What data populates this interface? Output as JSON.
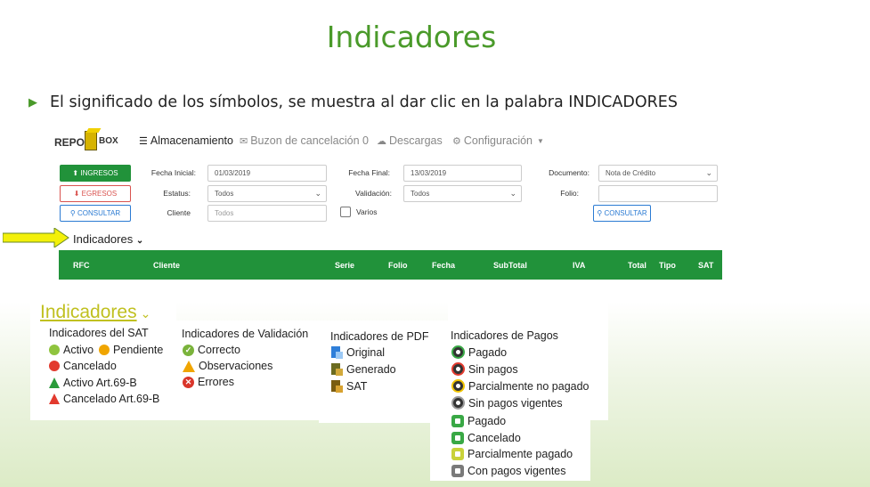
{
  "slide": {
    "title": "Indicadores",
    "bullet": "El significado de los símbolos, se muestra al dar clic en la palabra INDICADORES"
  },
  "app": {
    "logo": {
      "repo": "REPO",
      "box": "BOX"
    },
    "nav": {
      "storage": "Almacenamiento",
      "buzon": "Buzon de cancelación 0",
      "descargas": "Descargas",
      "configuracion": "Configuración"
    },
    "buttons": {
      "ingresos": "INGRESOS",
      "egresos": "EGRESOS",
      "consultar_left": "CONSULTAR",
      "consultar_right": "CONSULTAR"
    },
    "filters": {
      "fecha_inicial_label": "Fecha Inicial:",
      "fecha_inicial_value": "01/03/2019",
      "fecha_final_label": "Fecha Final:",
      "fecha_final_value": "13/03/2019",
      "documento_label": "Documento:",
      "documento_value": "Nota de Crédito",
      "estatus_label": "Estatus:",
      "estatus_value": "Todos",
      "validacion_label": "Validación:",
      "validacion_value": "Todos",
      "folio_label": "Folio:",
      "folio_value": "",
      "cliente_label": "Cliente",
      "cliente_placeholder": "Todos",
      "varios_label": "Varios"
    },
    "indicadores_link": "Indicadores",
    "table_headers": {
      "rfc": "RFC",
      "cliente": "Cliente",
      "serie": "Serie",
      "folio": "Folio",
      "fecha": "Fecha",
      "subtotal": "SubTotal",
      "iva": "IVA",
      "total": "Total",
      "tipo": "Tipo",
      "sat": "SAT"
    }
  },
  "legend": {
    "title": "Indicadores",
    "sat": {
      "title": "Indicadores del SAT",
      "activo": "Activo",
      "pendiente": "Pendiente",
      "cancelado": "Cancelado",
      "activo_69b": "Activo Art.69-B",
      "cancelado_69b": "Cancelado Art.69-B"
    },
    "validacion": {
      "title": "Indicadores de Validación",
      "correcto": "Correcto",
      "observaciones": "Observaciones",
      "errores": "Errores"
    },
    "pdf": {
      "title": "Indicadores de PDF",
      "original": "Original",
      "generado": "Generado",
      "sat": "SAT"
    },
    "pagos": {
      "title": "Indicadores de Pagos",
      "pagado": "Pagado",
      "sin_pagos": "Sin pagos",
      "parcialmente_no_pagado": "Parcialmente no pagado",
      "sin_pagos_vigentes": "Sin pagos vigentes",
      "pagado_2": "Pagado",
      "cancelado": "Cancelado",
      "parcialmente_pagado": "Parcialmente pagado",
      "con_pagos_vigentes": "Con pagos vigentes"
    }
  },
  "colors": {
    "accent_green": "#4a9a2a",
    "table_green": "#21923a",
    "legend_title": "#c0c020",
    "red": "#d9362b",
    "orange": "#f0a500",
    "blue": "#2b7bd3"
  }
}
